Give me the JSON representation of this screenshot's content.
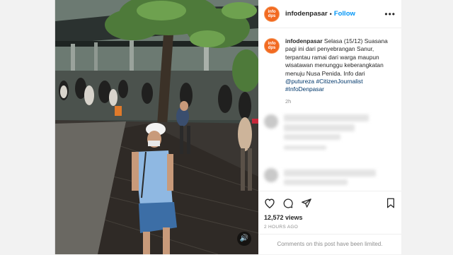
{
  "post": {
    "username": "infodenpasar",
    "follow_label": "Follow",
    "more_label": "•••",
    "avatar_text_line1": "info",
    "avatar_text_line2": "dps",
    "caption_user": "infodenpasar",
    "caption_text": "Selasa (15/12) Suasana pagi ini dari penyebrangan Sanur, terpantau ramai dari warga maupun wisatawan menunggu keberangkatan menuju Nusa Penida. Info dari",
    "mention": "@putureza",
    "hashtag1": "#CitizenJournalist",
    "hashtag2": "#InfoDenpasar",
    "caption_time": "2h",
    "views": "12,572 views",
    "posted_ago": "2 HOURS AGO",
    "comments_limited": "Comments on this post have been limited.",
    "volume_icon": "speaker-icon"
  },
  "colors": {
    "follow": "#0095f6",
    "avatar_bg": "#f26a21",
    "muted": "#8e8e8e"
  }
}
